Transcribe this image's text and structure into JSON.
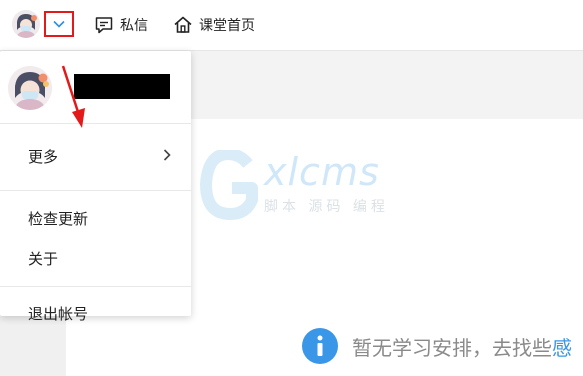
{
  "header": {
    "nav": [
      {
        "label": "私信",
        "icon": "message-icon"
      },
      {
        "label": "课堂首页",
        "icon": "home-icon"
      }
    ]
  },
  "watermark": {
    "brand": "xlcms",
    "subtitle": "脚本 源码 编程"
  },
  "menu": {
    "items": [
      {
        "label": "更多",
        "has_submenu": true
      },
      {
        "label": "检查更新"
      },
      {
        "label": "关于"
      },
      {
        "label": "退出帐号"
      }
    ]
  },
  "empty_state": {
    "text": "暂无学习安排，去找些",
    "link": "感"
  },
  "colors": {
    "accent": "#3a96e6",
    "highlight_border": "#e21a1a",
    "annotation_arrow": "#e21a1a"
  }
}
